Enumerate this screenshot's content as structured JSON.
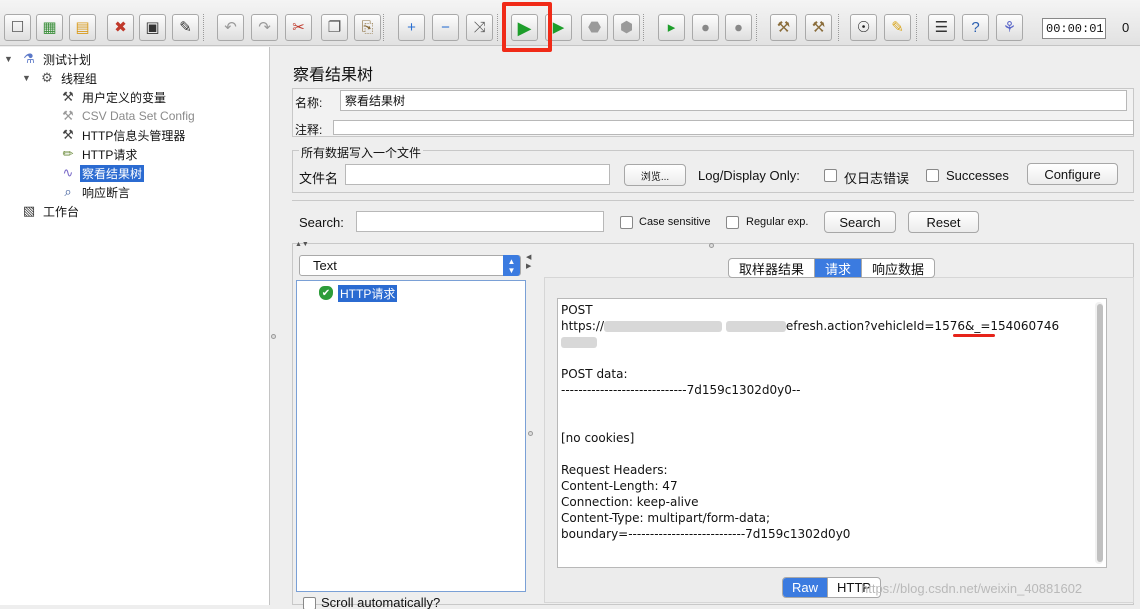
{
  "toolbar": {
    "buttons": [
      {
        "name": "new-icon",
        "glyph": "☐",
        "color": "#555555"
      },
      {
        "name": "templates-icon",
        "glyph": "▦",
        "color": "#3a8f3a"
      },
      {
        "name": "open-icon",
        "glyph": "▤",
        "color": "#d99a1a"
      },
      {
        "name": "close-icon",
        "glyph": "✖",
        "color": "#c0392b"
      },
      {
        "name": "save-icon",
        "glyph": "▣",
        "color": "#333333"
      },
      {
        "name": "save-as-icon",
        "glyph": "✎",
        "color": "#333333"
      },
      {
        "name": "undo-icon",
        "glyph": "↶",
        "color": "#9a9a9a"
      },
      {
        "name": "redo-icon",
        "glyph": "↷",
        "color": "#9a9a9a"
      },
      {
        "name": "cut-icon",
        "glyph": "✂",
        "color": "#c0392b"
      },
      {
        "name": "copy-icon",
        "glyph": "❐",
        "color": "#555555"
      },
      {
        "name": "paste-icon",
        "glyph": "⎘",
        "color": "#8a6d3b"
      },
      {
        "name": "expand-icon",
        "glyph": "+",
        "color": "#2a6fd1"
      },
      {
        "name": "collapse-icon",
        "glyph": "−",
        "color": "#2a6fd1"
      },
      {
        "name": "toggle-icon",
        "glyph": "⤨",
        "color": "#555555"
      },
      {
        "name": "start-icon",
        "glyph": "▶",
        "color": "#1e9e2b"
      },
      {
        "name": "start-no-pause-icon",
        "glyph": "▶",
        "color": "#1e9e2b"
      },
      {
        "name": "stop-icon",
        "glyph": "⬣",
        "color": "#9a9a9a"
      },
      {
        "name": "shutdown-icon",
        "glyph": "⬢",
        "color": "#9a9a9a"
      },
      {
        "name": "remote-start-icon",
        "glyph": "▸",
        "color": "#1e9e2b"
      },
      {
        "name": "remote-stop-icon",
        "glyph": "⦁",
        "color": "#888888"
      },
      {
        "name": "remote-shutdown-icon",
        "glyph": "⦁",
        "color": "#888888"
      },
      {
        "name": "clear-icon",
        "glyph": "⚒",
        "color": "#8a6d3b"
      },
      {
        "name": "clear-all-icon",
        "glyph": "⚒",
        "color": "#8a6d3b"
      },
      {
        "name": "search-icon",
        "glyph": "☉",
        "color": "#222222"
      },
      {
        "name": "reset-search-icon",
        "glyph": "✎",
        "color": "#d9a51a"
      },
      {
        "name": "function-helper-icon",
        "glyph": "☰",
        "color": "#333333"
      },
      {
        "name": "help-icon",
        "glyph": "?",
        "color": "#2a5fb0"
      },
      {
        "name": "log-viewer-icon",
        "glyph": "⚘",
        "color": "#5a66c8"
      }
    ],
    "timer": "00:00:01",
    "active_threads": "0"
  },
  "tree": {
    "nodes": [
      {
        "label": "测试计划",
        "icon": "test-plan-icon",
        "glyph": "⚗",
        "color": "#5b78c8",
        "state": "normal"
      },
      {
        "label": "线程组",
        "icon": "thread-group-icon",
        "glyph": "⚙",
        "color": "#555555",
        "state": "normal"
      },
      {
        "label": "用户定义的变量",
        "icon": "config-element-icon",
        "glyph": "⚒",
        "color": "#444444",
        "state": "normal"
      },
      {
        "label": "CSV Data Set Config",
        "icon": "config-element-disabled-icon",
        "glyph": "⚒",
        "color": "#9a9a9a",
        "state": "disabled"
      },
      {
        "label": "HTTP信息头管理器",
        "icon": "header-manager-icon",
        "glyph": "⚒",
        "color": "#444444",
        "state": "normal"
      },
      {
        "label": "HTTP请求",
        "icon": "sampler-icon",
        "glyph": "✏",
        "color": "#6a8a3a",
        "state": "normal"
      },
      {
        "label": "察看结果树",
        "icon": "listener-icon",
        "glyph": "∿",
        "color": "#7a6ac8",
        "state": "selected"
      },
      {
        "label": "响应断言",
        "icon": "assertion-icon",
        "glyph": "⌕",
        "color": "#3a5a9a",
        "state": "normal"
      },
      {
        "label": "工作台",
        "icon": "workbench-icon",
        "glyph": "▧",
        "color": "#333333",
        "state": "normal"
      }
    ]
  },
  "panel": {
    "title": "察看结果树",
    "name_label": "名称:",
    "name_value": "察看结果树",
    "comment_label": "注释:",
    "comment_value": "",
    "file_group_legend": "所有数据写入一个文件",
    "filename_label": "文件名",
    "filename_value": "",
    "browse_label": "浏览...",
    "log_display_label": "Log/Display Only:",
    "errors_only_label": "仅日志错误",
    "successes_label": "Successes",
    "configure_label": "Configure",
    "search_label": "Search:",
    "search_value": "",
    "case_sensitive_label": "Case sensitive",
    "regular_exp_label": "Regular exp.",
    "search_button": "Search",
    "reset_button": "Reset"
  },
  "results": {
    "renderer": "Text",
    "items": [
      {
        "label": "HTTP请求",
        "status": "success"
      }
    ],
    "scroll_auto_label": "Scroll automatically?"
  },
  "detail": {
    "tabs": [
      {
        "label": "取样器结果",
        "active": false
      },
      {
        "label": "请求",
        "active": true
      },
      {
        "label": "响应数据",
        "active": false
      }
    ],
    "request": {
      "method": "POST",
      "url_prefix": "https://",
      "url_suffix": "efresh.action?vehicleId=1576&_=154060746",
      "post_data_label": "POST data:",
      "post_data_value": "-----------------------------7d159c1302d0y0--",
      "cookies": "[no cookies]",
      "headers_label": "Request Headers:",
      "headers": [
        "Content-Length: 47",
        "Connection: keep-alive",
        "Content-Type: multipart/form-data;",
        "boundary=---------------------------7d159c1302d0y0"
      ]
    },
    "view_modes": [
      {
        "label": "Raw",
        "active": true
      },
      {
        "label": "HTTP",
        "active": false
      }
    ]
  },
  "watermark": "https://blog.csdn.net/weixin_40881602",
  "colors": {
    "highlight": "#f02a17",
    "selection": "#2b6bd1",
    "tab_active": "#3b7be0"
  }
}
